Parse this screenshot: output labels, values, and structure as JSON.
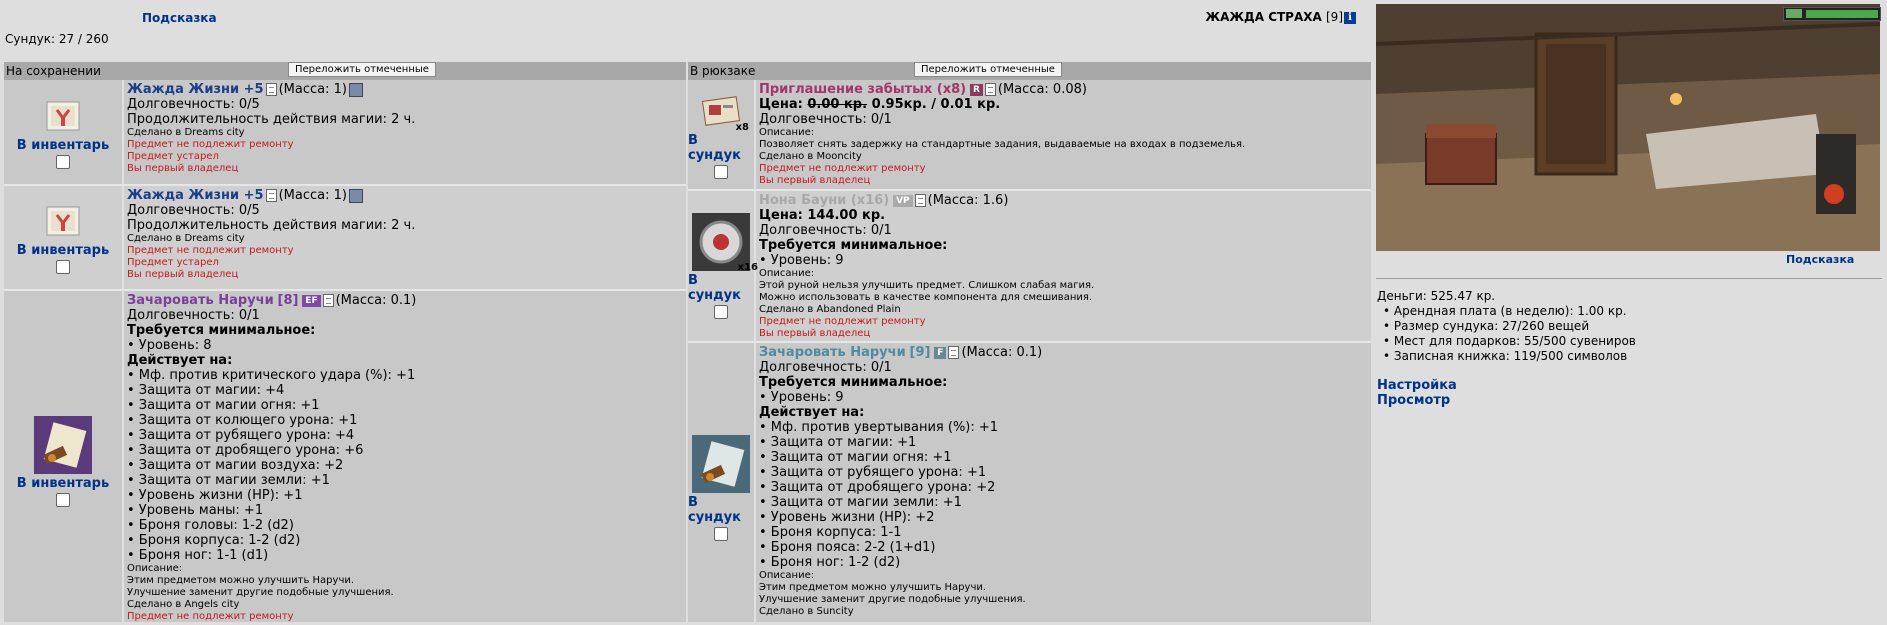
{
  "top": {
    "hint": "Подсказка",
    "char_name": "ЖАЖДА СТРАХА",
    "char_level": "[9]",
    "chest_count": "Сундук: 27 / 260"
  },
  "left": {
    "title": "На сохранении",
    "move_button": "Переложить отмеченные",
    "items": [
      {
        "action": "В инвентарь",
        "name": "Жажда Жизни +5",
        "mass": "(Масса: 1)",
        "lines": [
          "Долговечность: 0/5",
          "Продолжительность действия магии: 2 ч."
        ],
        "made": "Сделано в Dreams city",
        "warnings": [
          "Предмет не подлежит ремонту",
          "Предмет устарел",
          "Вы первый владелец"
        ]
      },
      {
        "action": "В инвентарь",
        "name": "Жажда Жизни +5",
        "mass": "(Масса: 1)",
        "lines": [
          "Долговечность: 0/5",
          "Продолжительность действия магии: 2 ч."
        ],
        "made": "Сделано в Dreams city",
        "warnings": [
          "Предмет не подлежит ремонту",
          "Предмет устарел",
          "Вы первый владелец"
        ]
      },
      {
        "action": "В инвентарь",
        "name": "Зачаровать Наручи",
        "level": "[8]",
        "badge": "EF",
        "mass": "(Масса: 0.1)",
        "durability": "Долговечность: 0/1",
        "req_title": "Требуется минимальное:",
        "req": "• Уровень: 8",
        "acts_title": "Действует на:",
        "acts": [
          "• Мф. против критического удара (%): +1",
          "• Защита от магии: +4",
          "• Защита от магии огня: +1",
          "• Защита от колющего урона: +1",
          "• Защита от рубящего урона: +4",
          "• Защита от дробящего урона: +6",
          "• Защита от магии воздуха: +2",
          "• Защита от магии земли: +1",
          "• Уровень жизни (HP): +1",
          "• Уровень маны: +1",
          "• Броня головы: 1-2 (d2)",
          "• Броня корпуса: 1-2 (d2)",
          "• Броня ног: 1-1 (d1)"
        ],
        "desc_title": "Описание:",
        "desc": [
          "Этим предметом можно улучшить Наручи.",
          "Улучшение заменит другие подобные улучшения."
        ],
        "made": "Сделано в Angels city",
        "warnings": [
          "Предмет не подлежит ремонту"
        ]
      }
    ]
  },
  "right": {
    "title": "В рюкзаке",
    "move_button": "Переложить отмеченные",
    "items": [
      {
        "action": "В сундук",
        "qty": "x8",
        "name": "Приглашение забытых (x8)",
        "badge": "R",
        "mass": "(Масса: 0.08)",
        "price_label": "Цена:",
        "price_old": "0.00 кр.",
        "price_new": "0.95кр. / 0.01 кр.",
        "durability": "Долговечность: 0/1",
        "desc_title": "Описание:",
        "desc": [
          "Позволяет снять задержку на стандартные задания, выдаваемые на входах в подземелья."
        ],
        "made": "Сделано в Mooncity",
        "warnings": [
          "Предмет не подлежит ремонту",
          "Вы первый владелец"
        ]
      },
      {
        "action": "В сундук",
        "qty": "x16",
        "name": "Нона Бауни (x16)",
        "badge": "VP",
        "mass": "(Масса: 1.6)",
        "price": "Цена: 144.00 кр.",
        "durability": "Долговечность: 0/1",
        "req_title": "Требуется минимальное:",
        "req": "• Уровень: 9",
        "desc_title": "Описание:",
        "desc": [
          "Этой руной нельзя улучшить предмет. Слишком слабая магия.",
          "Можно использовать в качестве компонента для смешивания."
        ],
        "made": "Сделано в Abandoned Plain",
        "warnings": [
          "Предмет не подлежит ремонту",
          "Вы первый владелец"
        ]
      },
      {
        "action": "В сундук",
        "name": "Зачаровать Наручи",
        "level": "[9]",
        "badge": "F",
        "mass": "(Масса: 0.1)",
        "durability": "Долговечность: 0/1",
        "req_title": "Требуется минимальное:",
        "req": "• Уровень: 9",
        "acts_title": "Действует на:",
        "acts": [
          "• Мф. против увертывания (%): +1",
          "• Защита от магии: +1",
          "• Защита от магии огня: +1",
          "• Защита от рубящего урона: +1",
          "• Защита от дробящего урона: +2",
          "• Защита от магии земли: +1",
          "• Уровень жизни (HP): +2",
          "• Броня корпуса: 1-1",
          "• Броня пояса: 2-2 (1+d1)",
          "• Броня ног: 1-2 (d2)"
        ],
        "desc_title": "Описание:",
        "desc": [
          "Этим предметом можно улучшить Наручи.",
          "Улучшение заменит другие подобные улучшения."
        ],
        "made": "Сделано в Suncity"
      }
    ]
  },
  "side": {
    "hint": "Подсказка",
    "money": "Деньги: 525.47 кр.",
    "stats": [
      "Арендная плата (в неделю): 1.00 кр.",
      "Размер сундука: 27/260 вещей",
      "Мест для подарков: 55/500 сувениров",
      "Записная книжка: 119/500 символов"
    ],
    "settings": "Настройка",
    "view": "Просмотр"
  }
}
